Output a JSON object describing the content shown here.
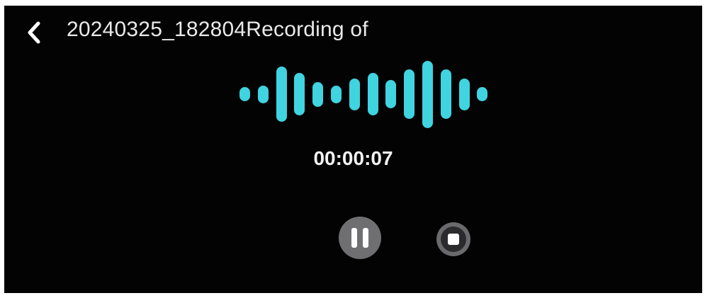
{
  "header": {
    "back_icon": "chevron-left-icon",
    "title": "20240325_182804Recording of"
  },
  "recorder": {
    "timer": "00:00:07",
    "waveform_color": "#3fd4e0",
    "waveform_levels": [
      0.2,
      0.25,
      0.78,
      0.6,
      0.35,
      0.25,
      0.45,
      0.6,
      0.4,
      0.7,
      0.95,
      0.7,
      0.45,
      0.2
    ],
    "pause_icon": "pause-icon",
    "stop_icon": "stop-icon"
  },
  "colors": {
    "background": "#030303",
    "text": "#e9e9e9",
    "button": "#6f6f72"
  }
}
